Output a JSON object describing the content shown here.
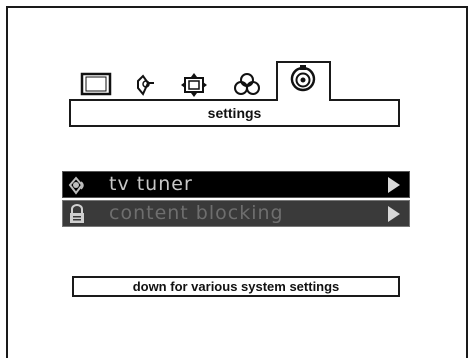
{
  "header": {
    "tabs": [
      {
        "icon": "screen-icon",
        "active": false
      },
      {
        "icon": "sound-icon",
        "active": false
      },
      {
        "icon": "picture-size-icon",
        "active": false
      },
      {
        "icon": "color-icon",
        "active": false
      },
      {
        "icon": "settings-icon",
        "active": true
      }
    ],
    "title": "settings"
  },
  "menu": {
    "items": [
      {
        "label": "tv tuner",
        "icon": "antenna-icon",
        "selected": true
      },
      {
        "label": "content blocking",
        "icon": "lock-icon",
        "selected": false
      }
    ]
  },
  "hint": "down for various system settings",
  "colors": {
    "selected_row_bg": "#000000",
    "row_bg": "#3a3a3a",
    "arrow": "#d8d8d8",
    "border": "#1a1a1a"
  }
}
